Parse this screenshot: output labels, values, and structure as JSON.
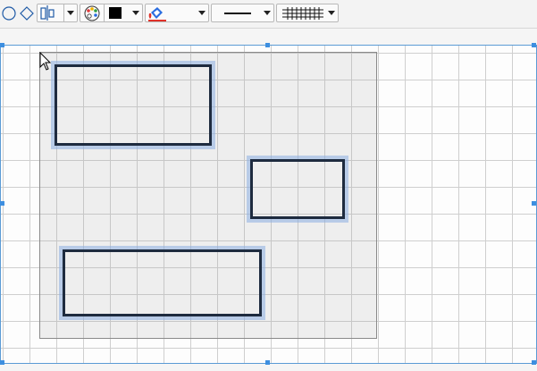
{
  "toolbar": {
    "shape_tools": [
      {
        "name": "circle-shape-icon",
        "icon": "circle"
      },
      {
        "name": "diamond-shape-icon",
        "icon": "diamond"
      }
    ],
    "align_tool": {
      "icon": "align-center-icon"
    },
    "color_picker": {
      "icon": "palette-icon",
      "selected_color": "#000000"
    },
    "fill_tool": {
      "icon": "paint-bucket-icon",
      "accent": "#2a6de0",
      "accent2": "#e0322a"
    },
    "line_style": {
      "icon": "solid-line-icon"
    },
    "grid_style": {
      "icon": "grid-lines-icon"
    }
  },
  "canvas": {
    "selection_color": "#3d8fe0",
    "rectangles": [
      {
        "name": "rectangle-top-left"
      },
      {
        "name": "rectangle-right"
      },
      {
        "name": "rectangle-bottom"
      }
    ]
  }
}
